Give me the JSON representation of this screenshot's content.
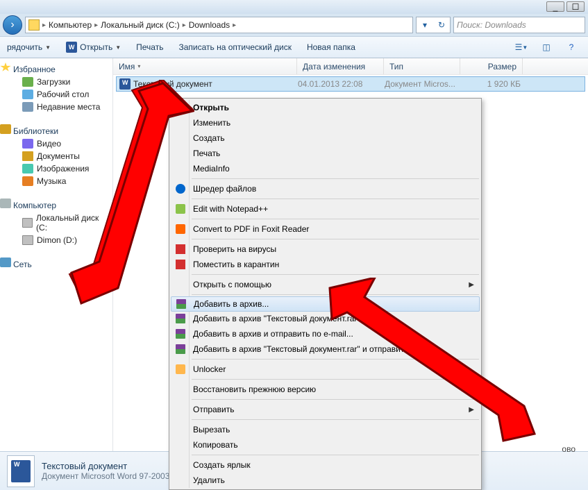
{
  "titlebar": {
    "minimize": "_",
    "maximize": "☐"
  },
  "breadcrumb": {
    "items": [
      "Компьютер",
      "Локальный диск (C:)",
      "Downloads"
    ]
  },
  "search": {
    "placeholder": "Поиск: Downloads"
  },
  "toolbar": {
    "organize": "рядочить",
    "open": "Открыть",
    "print": "Печать",
    "burn": "Записать на оптический диск",
    "newfolder": "Новая папка"
  },
  "sidebar": {
    "favorites": {
      "header": "Избранное",
      "items": [
        "Загрузки",
        "Рабочий стол",
        "Недавние места"
      ]
    },
    "libraries": {
      "header": "Библиотеки",
      "items": [
        "Видео",
        "Документы",
        "Изображения",
        "Музыка"
      ]
    },
    "computer": {
      "header": "Компьютер",
      "items": [
        "Локальный диск (C:",
        "Dimon (D:)"
      ]
    },
    "network": {
      "header": "Сеть"
    }
  },
  "columns": {
    "name": "Имя",
    "date": "Дата изменения",
    "type": "Тип",
    "size": "Размер"
  },
  "files": [
    {
      "name": "Текстовый документ",
      "date": "04.01.2013 22:08",
      "type": "Документ Micros...",
      "size": "1 920 КБ"
    }
  ],
  "details": {
    "title": "Текстовый документ",
    "sub": "Документ Microsoft Word 97-2003"
  },
  "extra_label": "ово",
  "context_menu": {
    "open": "Открыть",
    "edit": "Изменить",
    "create": "Создать",
    "print": "Печать",
    "mediainfo": "MediaInfo",
    "shredder": "Шредер файлов",
    "notepad": "Edit with Notepad++",
    "foxit": "Convert to PDF in Foxit Reader",
    "virus_check": "Проверить на вирусы",
    "quarantine": "Поместить в карантин",
    "openwith": "Открыть с помощью",
    "add_archive": "Добавить в архив...",
    "add_archive_named": "Добавить в архив \"Текстовый документ.rar\"",
    "add_email": "Добавить в архив и отправить по e-mail...",
    "add_named_send": "Добавить в архив \"Текстовый документ.rar\" и отправить",
    "unlocker": "Unlocker",
    "restore": "Восстановить прежнюю версию",
    "sendto": "Отправить",
    "cut": "Вырезать",
    "copy": "Копировать",
    "shortcut": "Создать ярлык",
    "delete": "Удалить"
  }
}
